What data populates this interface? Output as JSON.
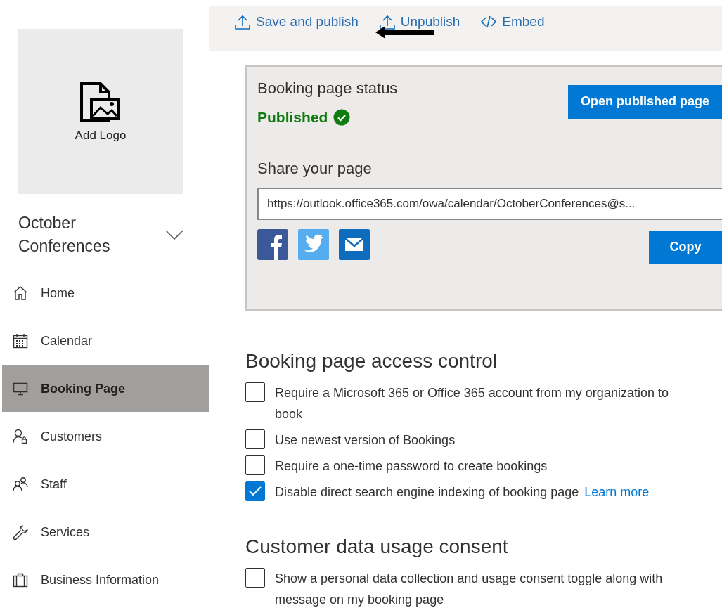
{
  "sidebar": {
    "logo": {
      "label": "Add Logo"
    },
    "business_name": "October Conferences",
    "items": [
      {
        "label": "Home",
        "selected": false
      },
      {
        "label": "Calendar",
        "selected": false
      },
      {
        "label": "Booking Page",
        "selected": true
      },
      {
        "label": "Customers",
        "selected": false
      },
      {
        "label": "Staff",
        "selected": false
      },
      {
        "label": "Services",
        "selected": false
      },
      {
        "label": "Business Information",
        "selected": false
      }
    ]
  },
  "toolbar": [
    {
      "label": "Save and publish"
    },
    {
      "label": "Unpublish"
    },
    {
      "label": "Embed"
    }
  ],
  "status_card": {
    "title": "Booking page status",
    "status": "Published",
    "open_button": "Open published page",
    "share_title": "Share your page",
    "url": "https://outlook.office365.com/owa/calendar/OctoberConferences@s...",
    "copy_button": "Copy"
  },
  "sections": [
    {
      "title": "Booking page access control",
      "options": [
        {
          "label": "Require a Microsoft 365 or Office 365 account from my organization to book",
          "checked": false
        },
        {
          "label": "Use newest version of Bookings",
          "checked": false
        },
        {
          "label": "Require a one-time password to create bookings",
          "checked": false
        },
        {
          "label": "Disable direct search engine indexing of booking page",
          "checked": true,
          "link": "Learn more"
        }
      ]
    },
    {
      "title": "Customer data usage consent",
      "options": [
        {
          "label": "Show a personal data collection and usage consent toggle along with message on my booking page",
          "checked": false
        }
      ]
    }
  ]
}
